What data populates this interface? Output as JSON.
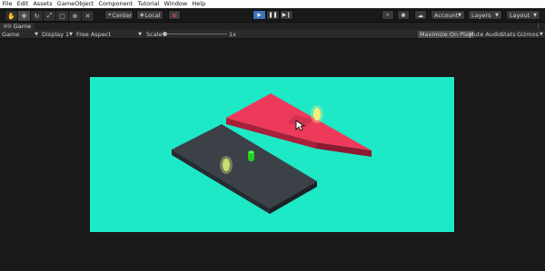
{
  "menu": [
    "File",
    "Edit",
    "Assets",
    "GameObject",
    "Component",
    "Tutorial",
    "Window",
    "Help"
  ],
  "toolbar": {
    "tools": [
      "hand-tool-icon",
      "move-tool-icon",
      "rotate-tool-icon",
      "scale-tool-icon",
      "rect-tool-icon",
      "transform-tool-icon",
      "custom-tool-icon"
    ],
    "pivot_label": "Center",
    "space_label": "Local",
    "account_label": "Account",
    "layers_label": "Layers",
    "layout_label": "Layout"
  },
  "game_tab": {
    "label": "Game"
  },
  "game_bar": {
    "mode": "Game",
    "display": "Display 1",
    "aspect": "Free Aspect",
    "scale_label": "Scale",
    "scale_value": "1x",
    "maximize_label": "Maximize On Play",
    "mute_label": "Mute Audio",
    "stats_label": "Stats",
    "gizmos_label": "Gizmos"
  },
  "colors": {
    "scene_background": "#1de9c6",
    "red_platform": "#ee3a5a",
    "dark_platform": "#3c4047",
    "player": "#22cc22",
    "portal": "#f4f080",
    "play_active": "#3b72b8"
  }
}
